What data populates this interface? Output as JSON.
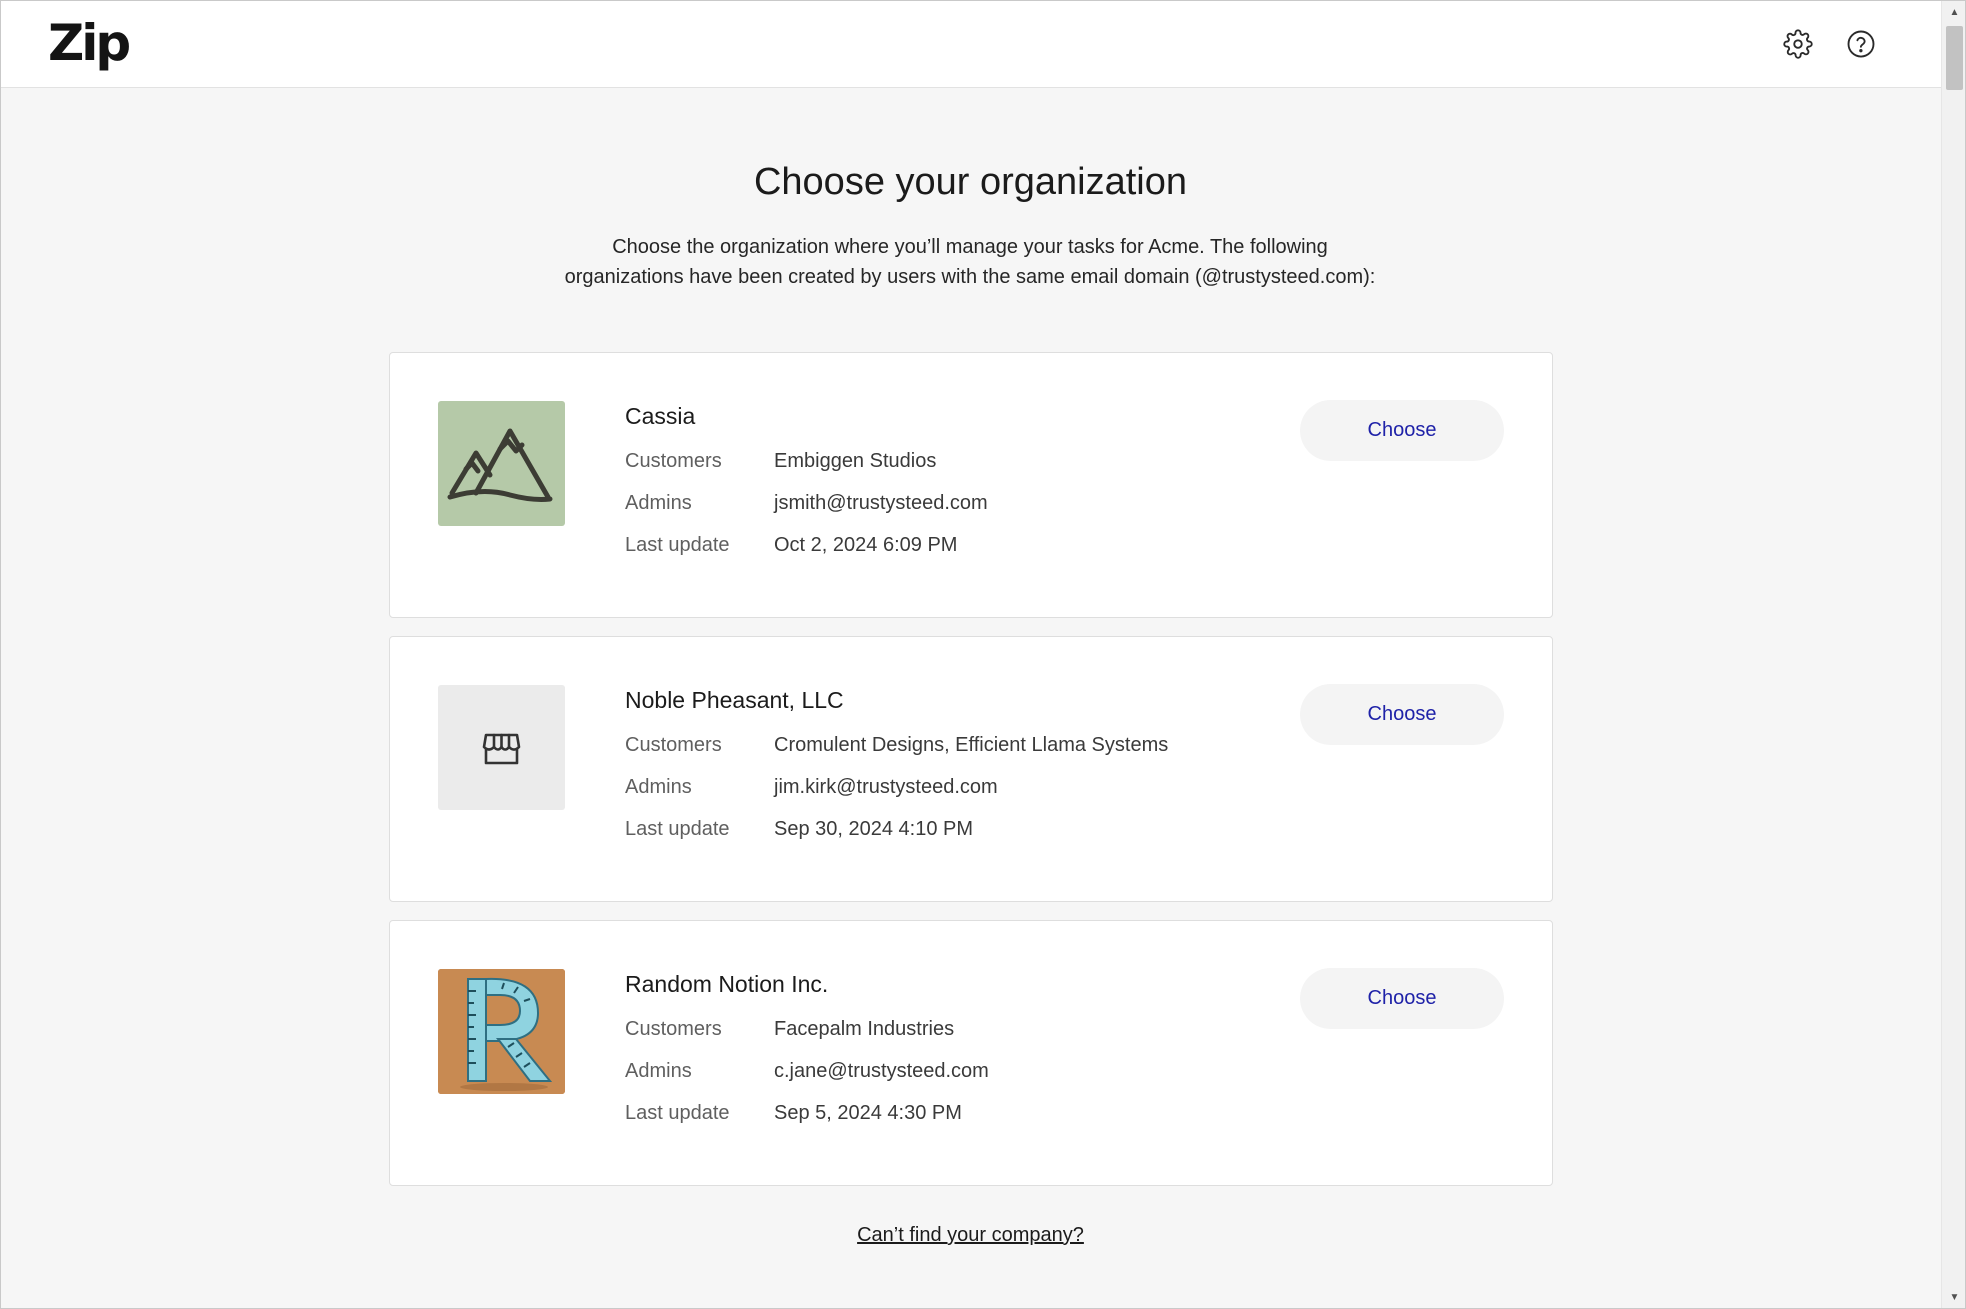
{
  "header": {
    "logo_text": "Zip",
    "settings_icon": "gear-icon",
    "help_icon": "help-circle-icon"
  },
  "page": {
    "title": "Choose your organization",
    "subtitle_line1": "Choose the organization where you’ll manage your tasks for Acme. The following",
    "subtitle_line2": "organizations have been created by users with the same email domain (@trustysteed.com):"
  },
  "labels": {
    "customers": "Customers",
    "admins": "Admins",
    "last_update": "Last update",
    "choose": "Choose"
  },
  "organizations": [
    {
      "name": "Cassia",
      "logo_icon": "mountains-icon",
      "logo_bg": "#b5c9a8",
      "customers": "Embiggen Studios",
      "admins": "jsmith@trustysteed.com",
      "last_update": "Oct 2, 2024 6:09 PM"
    },
    {
      "name": "Noble Pheasant, LLC",
      "logo_icon": "storefront-icon",
      "logo_bg": "#ebebeb",
      "customers": "Cromulent Designs, Efficient Llama Systems",
      "admins": "jim.kirk@trustysteed.com",
      "last_update": "Sep 30, 2024 4:10 PM"
    },
    {
      "name": "Random Notion Inc.",
      "logo_icon": "ruler-letter-r-icon",
      "logo_bg": "#c88a52",
      "customers": "Facepalm Industries",
      "admins": "c.jane@trustysteed.com",
      "last_update": "Sep 5, 2024 4:30 PM"
    }
  ],
  "footer": {
    "cant_find_link": "Can’t find your company?"
  },
  "colors": {
    "accent_button_text": "#1f22a8",
    "page_background": "#f6f6f6"
  }
}
